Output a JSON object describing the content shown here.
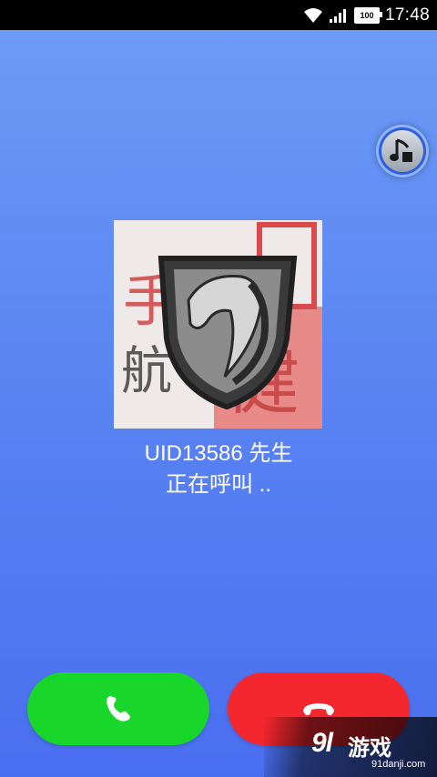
{
  "status_bar": {
    "time": "17:48",
    "battery": "100",
    "icons": [
      "wifi-icon",
      "signal-icon",
      "battery-icon"
    ]
  },
  "music_button": {
    "icon": "music-note-icon"
  },
  "avatar": {
    "description_icon": "horse-shield-logo",
    "chars": [
      "手",
      "航",
      "健"
    ]
  },
  "caller": {
    "name": "UID13586 先生",
    "status": "正在呼叫 .."
  },
  "buttons": {
    "answer_icon": "phone-icon",
    "hangup_icon": "phone-hangup-icon"
  },
  "watermark": {
    "logo": "9l",
    "text": "游戏",
    "url": "91danji.com"
  },
  "colors": {
    "background_top": "#6f9cf6",
    "background_bottom": "#4a6ef0",
    "answer": "#18d62a",
    "hangup": "#f4262e"
  }
}
